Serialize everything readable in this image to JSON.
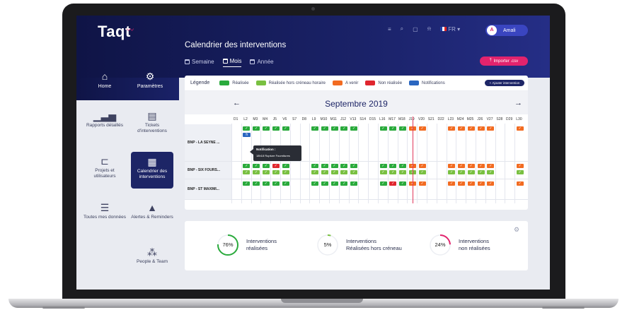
{
  "header": {
    "logo": "Taqt",
    "title": "Calendrier des interventions",
    "views": [
      {
        "label": "Semaine",
        "active": false
      },
      {
        "label": "Mois",
        "active": true
      },
      {
        "label": "Année",
        "active": false
      }
    ],
    "lang": "FR",
    "user_name": "Amali",
    "user_initial": "A",
    "import_label": "Importer .csv"
  },
  "sidebar": {
    "top": [
      {
        "label": "Home",
        "icon": "home-icon"
      },
      {
        "label": "Paramètres",
        "icon": "settings-icon"
      }
    ],
    "items": [
      {
        "label": "Rapports détaillés",
        "icon": "bar-chart-icon",
        "active": false
      },
      {
        "label": "Tickets d'interventions",
        "icon": "ticket-icon",
        "active": false
      },
      {
        "label": "Projets et utilisateurs",
        "icon": "project-icon",
        "active": false
      },
      {
        "label": "Calendrier des interventions",
        "icon": "calendar-icon",
        "active": true
      },
      {
        "label": "Toutes mes données",
        "icon": "database-icon",
        "active": false
      },
      {
        "label": "Alertes & Reminders",
        "icon": "bell-icon",
        "active": false
      },
      {
        "label": "People & Team",
        "icon": "people-icon",
        "active": false
      }
    ]
  },
  "legend": {
    "title": "Légende",
    "items": [
      {
        "label": "Réalisée",
        "color": "#2aaa3c"
      },
      {
        "label": "Réalisée hors créneau horaire",
        "color": "#79c041"
      },
      {
        "label": "A venir",
        "color": "#f26b21"
      },
      {
        "label": "Non réalisée",
        "color": "#e0262e"
      },
      {
        "label": "Notifications",
        "color": "#2a66c0"
      }
    ],
    "add_label": "Ajouter intervention"
  },
  "calendar": {
    "month": "Septembre 2019",
    "days": [
      "D1",
      "L2",
      "M3",
      "M4",
      "J5",
      "V6",
      "S7",
      "D8",
      "L9",
      "M10",
      "M11",
      "J12",
      "V13",
      "S14",
      "D15",
      "L16",
      "M17",
      "M18",
      "J19",
      "V20",
      "S21",
      "D22",
      "L23",
      "M24",
      "M25",
      "J26",
      "V27",
      "S28",
      "D29",
      "L30"
    ],
    "rows": [
      {
        "label": "BNP - LA SEYNE ...",
        "lines": [
          {
            "L2": "g",
            "M3": "g",
            "M4": "g",
            "J5": "g",
            "V6": "g",
            "L9": "g",
            "M10": "g",
            "M11": "g",
            "J12": "g",
            "V13": "g",
            "L16": "g",
            "M17": "g",
            "M18": "g",
            "J19": "o",
            "V20": "o",
            "L23": "o",
            "M24": "o",
            "M25": "o",
            "J26": "o",
            "V27": "o",
            "L30": "o"
          },
          {
            "L2": "b"
          }
        ]
      },
      {
        "label": "BNP - SIX FOURS...",
        "lines": [
          {
            "L2": "g",
            "M3": "g",
            "M4": "g",
            "J5": "r",
            "V6": "g",
            "L9": "g",
            "M10": "g",
            "M11": "g",
            "J12": "g",
            "V13": "g",
            "L16": "g",
            "M17": "g",
            "M18": "g",
            "J19": "o",
            "V20": "o",
            "L23": "o",
            "M24": "o",
            "M25": "o",
            "J26": "o",
            "V27": "o",
            "L30": "o"
          },
          {
            "L2": "lg",
            "M3": "lg",
            "M4": "lg",
            "J5": "lg",
            "V6": "lg",
            "L9": "lg",
            "M10": "lg",
            "M11": "lg",
            "J12": "lg",
            "V13": "lg",
            "L16": "lg",
            "M17": "lg",
            "M18": "lg",
            "J19": "lg",
            "V20": "lg",
            "L23": "lg",
            "M24": "lg",
            "M25": "lg",
            "J26": "lg",
            "V27": "lg",
            "L30": "lg"
          }
        ]
      },
      {
        "label": "BNP - ST MAXIMI...",
        "lines": [
          {
            "L2": "g",
            "M3": "g",
            "M4": "g",
            "J5": "g",
            "V6": "g",
            "L9": "g",
            "M10": "g",
            "M11": "g",
            "J12": "g",
            "V13": "g",
            "L16": "g",
            "M17": "r",
            "M18": "g",
            "J19": "o",
            "V20": "o",
            "L23": "o",
            "M24": "o",
            "M25": "o",
            "J26": "o",
            "V27": "o",
            "L30": "o"
          }
        ]
      }
    ],
    "tooltip": {
      "title": "Notification :",
      "text": "18h18 Rupture Fournitures"
    }
  },
  "stats": [
    {
      "value": 76,
      "label_line1": "Interventions",
      "label_line2": "réalisées",
      "color": "#2aaa3c"
    },
    {
      "value": 5,
      "label_line1": "Interventions",
      "label_line2": "Réalisées hors créneau",
      "color": "#79c041"
    },
    {
      "value": 24,
      "label_line1": "Interventions",
      "label_line2": "non réalisées",
      "color": "#e2236d"
    }
  ],
  "stats_text": {
    "s0": "76%",
    "s1": "5%",
    "s2": "24%"
  }
}
